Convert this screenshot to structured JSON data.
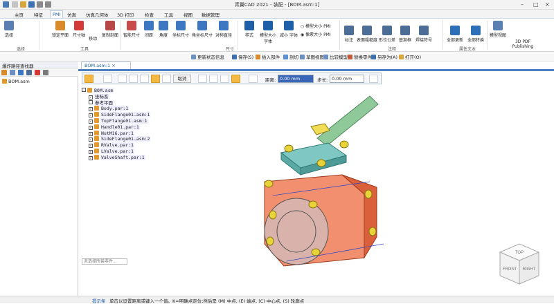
{
  "titlebar": {
    "title": "青翼CAD 2021 - 装配 - [BOM.asm:1]"
  },
  "menu": {
    "tabs": [
      "主页",
      "特征",
      "PMI",
      "仿真",
      "仿真几何体",
      "3D 打印",
      "检查",
      "工具",
      "视图",
      "数据管理"
    ],
    "active": "PMI"
  },
  "ribbon": {
    "buttons": [
      {
        "label": "选择",
        "color": "#5a7fb0"
      },
      {
        "label": "锁定平面",
        "color": "#d98b2b"
      },
      {
        "label": "尺寸轴",
        "color": "#d33b3b"
      },
      {
        "label": "移动",
        "color": "#6d6d6d"
      },
      {
        "label": "复制剖面",
        "color": "#b84848"
      },
      {
        "label": "智能尺寸",
        "color": "#c94a4a"
      },
      {
        "label": "间距",
        "color": "#3d77c2"
      },
      {
        "label": "角度",
        "color": "#3d77c2"
      },
      {
        "label": "坐标尺寸",
        "color": "#3d77c2"
      },
      {
        "label": "角坐标尺寸",
        "color": "#3d77c2"
      },
      {
        "label": "对称直径",
        "color": "#3d77c2"
      },
      {
        "label": "样式",
        "color": "#1f5fa8"
      },
      {
        "label": "模型大小 字体",
        "color": "#1f5fa8"
      },
      {
        "label": "减小 字体",
        "color": "#1f5fa8"
      },
      {
        "label": "标注",
        "color": "#4c6d96"
      },
      {
        "label": "表面粗糙度",
        "color": "#4c6d96"
      },
      {
        "label": "形位公差",
        "color": "#4c6d96"
      },
      {
        "label": "基准框",
        "color": "#4c6d96"
      },
      {
        "label": "焊接符号",
        "color": "#4c6d96"
      },
      {
        "label": "全部更新",
        "color": "#2f6fb5"
      },
      {
        "label": "全部转换",
        "color": "#2f6fb5"
      },
      {
        "label": "模型视图",
        "color": "#5a7fb0"
      },
      {
        "label": "3D PDF Publishing",
        "color": "#7a7a7a"
      }
    ],
    "radio": [
      {
        "label": "模型大小 PMI",
        "checked": false
      },
      {
        "label": "像素大小 PMI",
        "checked": true
      }
    ],
    "groups": [
      "选择",
      "工具",
      "尺寸",
      "注释",
      "属性文本"
    ]
  },
  "cmdbar": {
    "items": [
      "更新状态信息",
      "保存(S)",
      "插入部件",
      "剖切",
      "草图视图",
      "比较模型",
      "替换零件",
      "另存为(A)",
      "打开(O)"
    ]
  },
  "leftpanel": {
    "title": "爆炸路径查找器",
    "root": "BOM.asm"
  },
  "doctab": {
    "label": "BOM.asm:1"
  },
  "qtool": {
    "cancel": "取消",
    "distance_label": "距离:",
    "distance_value": "0.00 mm",
    "step_label": "步长:",
    "step_value": "0.00 mm"
  },
  "tree": {
    "nodes": [
      {
        "label": "BOM.asm",
        "indent": 0,
        "check": false,
        "icon": true
      },
      {
        "label": "坐标系",
        "indent": 1,
        "check": true,
        "icon": false
      },
      {
        "label": "参考平面",
        "indent": 1,
        "check": false,
        "icon": false
      },
      {
        "label": "Body.par:1",
        "indent": 1,
        "check": true,
        "icon": true
      },
      {
        "label": "SideFlange01.asm:1",
        "indent": 1,
        "check": true,
        "icon": true
      },
      {
        "label": "TopFlange01.asm:1",
        "indent": 1,
        "check": true,
        "icon": true
      },
      {
        "label": "Handle01.par:1",
        "indent": 1,
        "check": true,
        "icon": true
      },
      {
        "label": "NutM16.par:1",
        "indent": 1,
        "check": true,
        "icon": true
      },
      {
        "label": "SideFlange01.asm:2",
        "indent": 1,
        "check": true,
        "icon": true
      },
      {
        "label": "RValve.par:1",
        "indent": 1,
        "check": true,
        "icon": true
      },
      {
        "label": "LValve.par:1",
        "indent": 1,
        "check": true,
        "icon": true
      },
      {
        "label": "ValveShaft.par:1",
        "indent": 1,
        "check": true,
        "icon": true
      }
    ]
  },
  "hint": "未选择所装零件...",
  "viewcube": {
    "top": "TOP",
    "front": "FRONT",
    "right": "RIGHT"
  },
  "status": {
    "label": "提示条",
    "message": "单击以设置距离或键入一个值。K=明确点定位;然后是 (M) 中点, (E) 端点, (C) 中心点, (S) 轮廓点"
  },
  "colors": {
    "accent": "#1f5fa8",
    "body": "#f07b55",
    "handle": "#7fbf88",
    "bolts": "#e8d43a"
  }
}
